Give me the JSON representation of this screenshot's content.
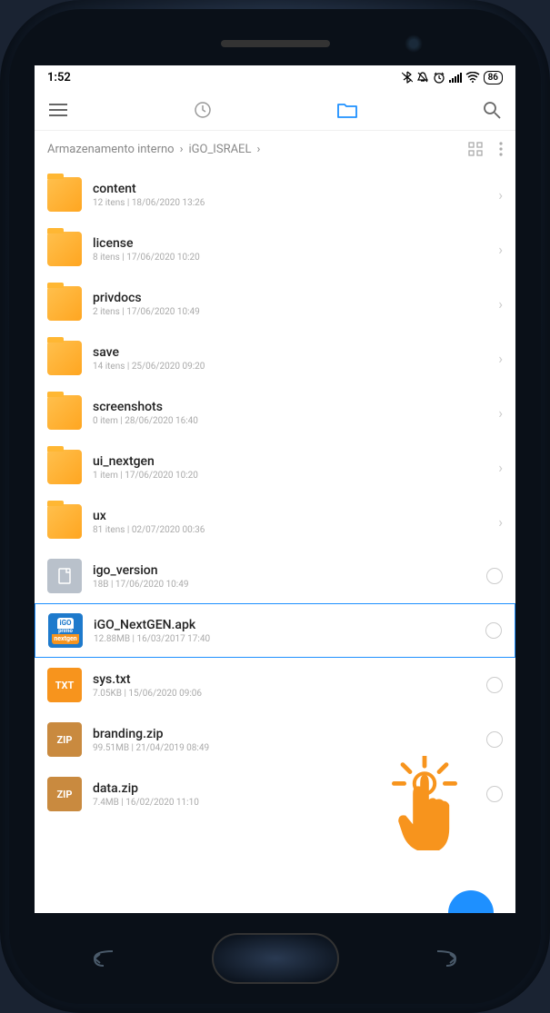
{
  "status_bar": {
    "time": "1:52",
    "battery": "86"
  },
  "breadcrumb": {
    "root": "Armazenamento interno",
    "folder": "iGO_ISRAEL"
  },
  "items": [
    {
      "type": "folder",
      "name": "content",
      "meta": "12 itens  |  18/06/2020 13:26"
    },
    {
      "type": "folder",
      "name": "license",
      "meta": "8 itens  |  17/06/2020 10:20"
    },
    {
      "type": "folder",
      "name": "privdocs",
      "meta": "2 itens  |  17/06/2020 10:49"
    },
    {
      "type": "folder",
      "name": "save",
      "meta": "14 itens  |  25/06/2020 09:20"
    },
    {
      "type": "folder",
      "name": "screenshots",
      "meta": "0 item  |  28/06/2020 16:40"
    },
    {
      "type": "folder",
      "name": "ui_nextgen",
      "meta": "1 item  |  17/06/2020 10:20"
    },
    {
      "type": "folder",
      "name": "ux",
      "meta": "81 itens  |  02/07/2020 00:36"
    },
    {
      "type": "doc",
      "name": "igo_version",
      "meta": "18B  |  17/06/2020 10:49"
    },
    {
      "type": "apk",
      "name": "iGO_NextGEN.apk",
      "meta": "12.88MB  |  16/03/2017 17:40",
      "highlighted": true
    },
    {
      "type": "txt",
      "name": "sys.txt",
      "meta": "7.05KB  |  15/06/2020 09:06"
    },
    {
      "type": "zip",
      "name": "branding.zip",
      "meta": "99.51MB  |  21/04/2019 08:49"
    },
    {
      "type": "zip",
      "name": "data.zip",
      "meta": "7.4MB  |  16/02/2020 11:10"
    }
  ],
  "apk_label": {
    "top": "iGO",
    "mid": "primo",
    "bot": "nextgen"
  },
  "icon_text": {
    "txt": "TXT",
    "zip": "ZIP"
  }
}
